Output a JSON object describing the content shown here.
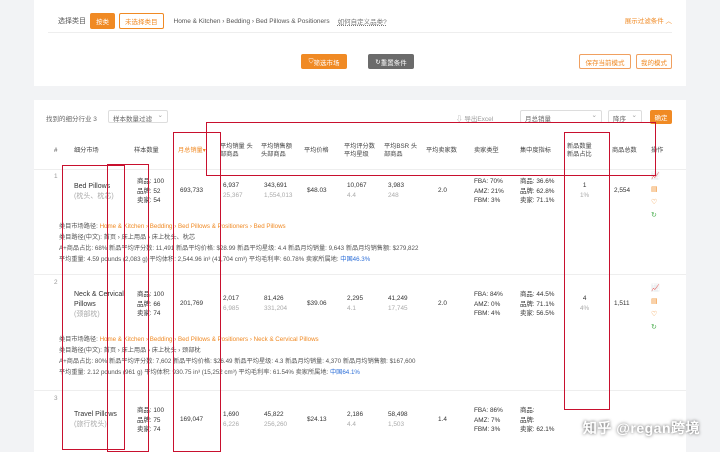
{
  "filter": {
    "label": "选择类目",
    "pill_active": "按类",
    "pill_other": "未选择类目",
    "crumb": "Home & Kitchen › Bedding › Bed Pillows & Positioners",
    "help": "如何自定义品类?",
    "toggle": "展示过滤条件",
    "btn_market": "筛选市场",
    "btn_reset": "重置条件",
    "btn_save": "保存当前模式",
    "btn_mine": "我的模式"
  },
  "toolbar": {
    "found": "找到的细分行业 3",
    "filter_select": "样本数量过滤",
    "export": "导出Excel",
    "sort_select": "月总销量",
    "order_select": "降序",
    "confirm": "确定"
  },
  "headers": {
    "idx": "#",
    "market": "细分市场",
    "samples": "样本数量",
    "monthly_sales": "月总销量",
    "avg_sales": "平均销量 头部商品",
    "avg_revenue": "平均销售额 头部商品",
    "avg_price": "平均价格",
    "avg_ratings": "平均评分数 平均星级",
    "avg_bsr": "平均BSR 头部商品",
    "avg_sellers": "平均卖家数",
    "seller_type": "卖家类型",
    "concentration": "集中度指标",
    "new_products": "新品数量 新品占比",
    "total_products": "商品总数",
    "ops": "操作"
  },
  "rows": [
    {
      "name": "Bed Pillows",
      "name_cn": "(枕头、枕芯)",
      "samples": [
        "商品: 100",
        "品牌: 52",
        "卖家: 54"
      ],
      "monthly_sales": "693,733",
      "avg_sales": "6,937",
      "avg_sales_sub": "25,367",
      "avg_revenue": "343,691",
      "avg_revenue_sub": "1,554,013",
      "avg_price": "$48.03",
      "avg_ratings": "10,067",
      "avg_stars": "4.4",
      "avg_bsr": "3,983",
      "avg_bsr_sub": "248",
      "avg_sellers": "2.0",
      "seller_type": [
        "FBA: 70%",
        "AMZ: 21%",
        "FBM: 3%"
      ],
      "concentration": [
        "商品: 36.6%",
        "品牌: 62.8%",
        "卖家: 71.1%"
      ],
      "new_count": "1",
      "new_ratio": "1%",
      "total": "2,554",
      "detail": {
        "path_label": "类目市场路径: ",
        "path": "Home & Kitchen › Bedding › Bed Pillows & Positioners › Bed Pillows",
        "line2": "类目路径(中文): 首页 › 床上用品 › 床上枕头、枕芯",
        "line3": "A+商品占比: 68%    新品平均评分数: 11,491    新品平均价格: $28.99    新品平均星级: 4.4    新品月均销量: 9,643    新品月均销售额: $279,822",
        "line4_a": "平均重量: 4.59 pounds (2,083 g)    平均体积: 2,544.96 in³ (41,704 cm³)    平均毛利率: 60.78%    卖家所属地: ",
        "line4_b": "中国46.3%"
      }
    },
    {
      "name": "Neck & Cervical Pillows",
      "name_cn": "(颈部枕)",
      "samples": [
        "商品: 100",
        "品牌: 66",
        "卖家: 74"
      ],
      "monthly_sales": "201,769",
      "avg_sales": "2,017",
      "avg_sales_sub": "6,985",
      "avg_revenue": "81,426",
      "avg_revenue_sub": "331,204",
      "avg_price": "$39.06",
      "avg_ratings": "2,295",
      "avg_stars": "4.1",
      "avg_bsr": "41,249",
      "avg_bsr_sub": "17,745",
      "avg_sellers": "2.0",
      "seller_type": [
        "FBA: 84%",
        "AMZ: 0%",
        "FBM: 4%"
      ],
      "concentration": [
        "商品: 44.5%",
        "品牌: 71.1%",
        "卖家: 56.5%"
      ],
      "new_count": "4",
      "new_ratio": "4%",
      "total": "1,511",
      "detail": {
        "path_label": "类目市场路径: ",
        "path": "Home & Kitchen › Bedding › Bed Pillows & Positioners › Neck & Cervical Pillows",
        "line2": "类目路径(中文): 首页 › 床上用品 › 床上枕头 › 颈部枕",
        "line3": "A+商品占比: 80%    新品平均评分数: 7,602    新品平均价格: $26.49    新品平均星级: 4.3    新品月均销量: 4,370    新品月均销售额: $167,600",
        "line4_a": "平均重量: 2.12 pounds (961 g)    平均体积: 930.75 in³ (15,252 cm³)    平均毛利率: 61.54%    卖家所属地: ",
        "line4_b": "中国64.1%"
      }
    },
    {
      "name": "Travel Pillows",
      "name_cn": "(旅行枕头)",
      "samples": [
        "商品: 100",
        "品牌: 75",
        "卖家: 74"
      ],
      "monthly_sales": "169,047",
      "avg_sales": "1,690",
      "avg_sales_sub": "6,226",
      "avg_revenue": "45,822",
      "avg_revenue_sub": "256,260",
      "avg_price": "$24.13",
      "avg_ratings": "2,186",
      "avg_stars": "4.4",
      "avg_bsr": "58,498",
      "avg_bsr_sub": "1,503",
      "avg_sellers": "1.4",
      "seller_type": [
        "FBA: 86%",
        "AMZ: 7%",
        "FBM: 3%"
      ],
      "concentration": [
        "商品: ",
        "品牌: ",
        "卖家: 62.1%"
      ],
      "new_count": "",
      "new_ratio": "",
      "total": "",
      "detail": null
    }
  ],
  "watermark": "知乎 @regan跨境",
  "colors": {
    "accent": "#f08a24",
    "annotation": "#c8102e",
    "link": "#2d6fd8"
  }
}
